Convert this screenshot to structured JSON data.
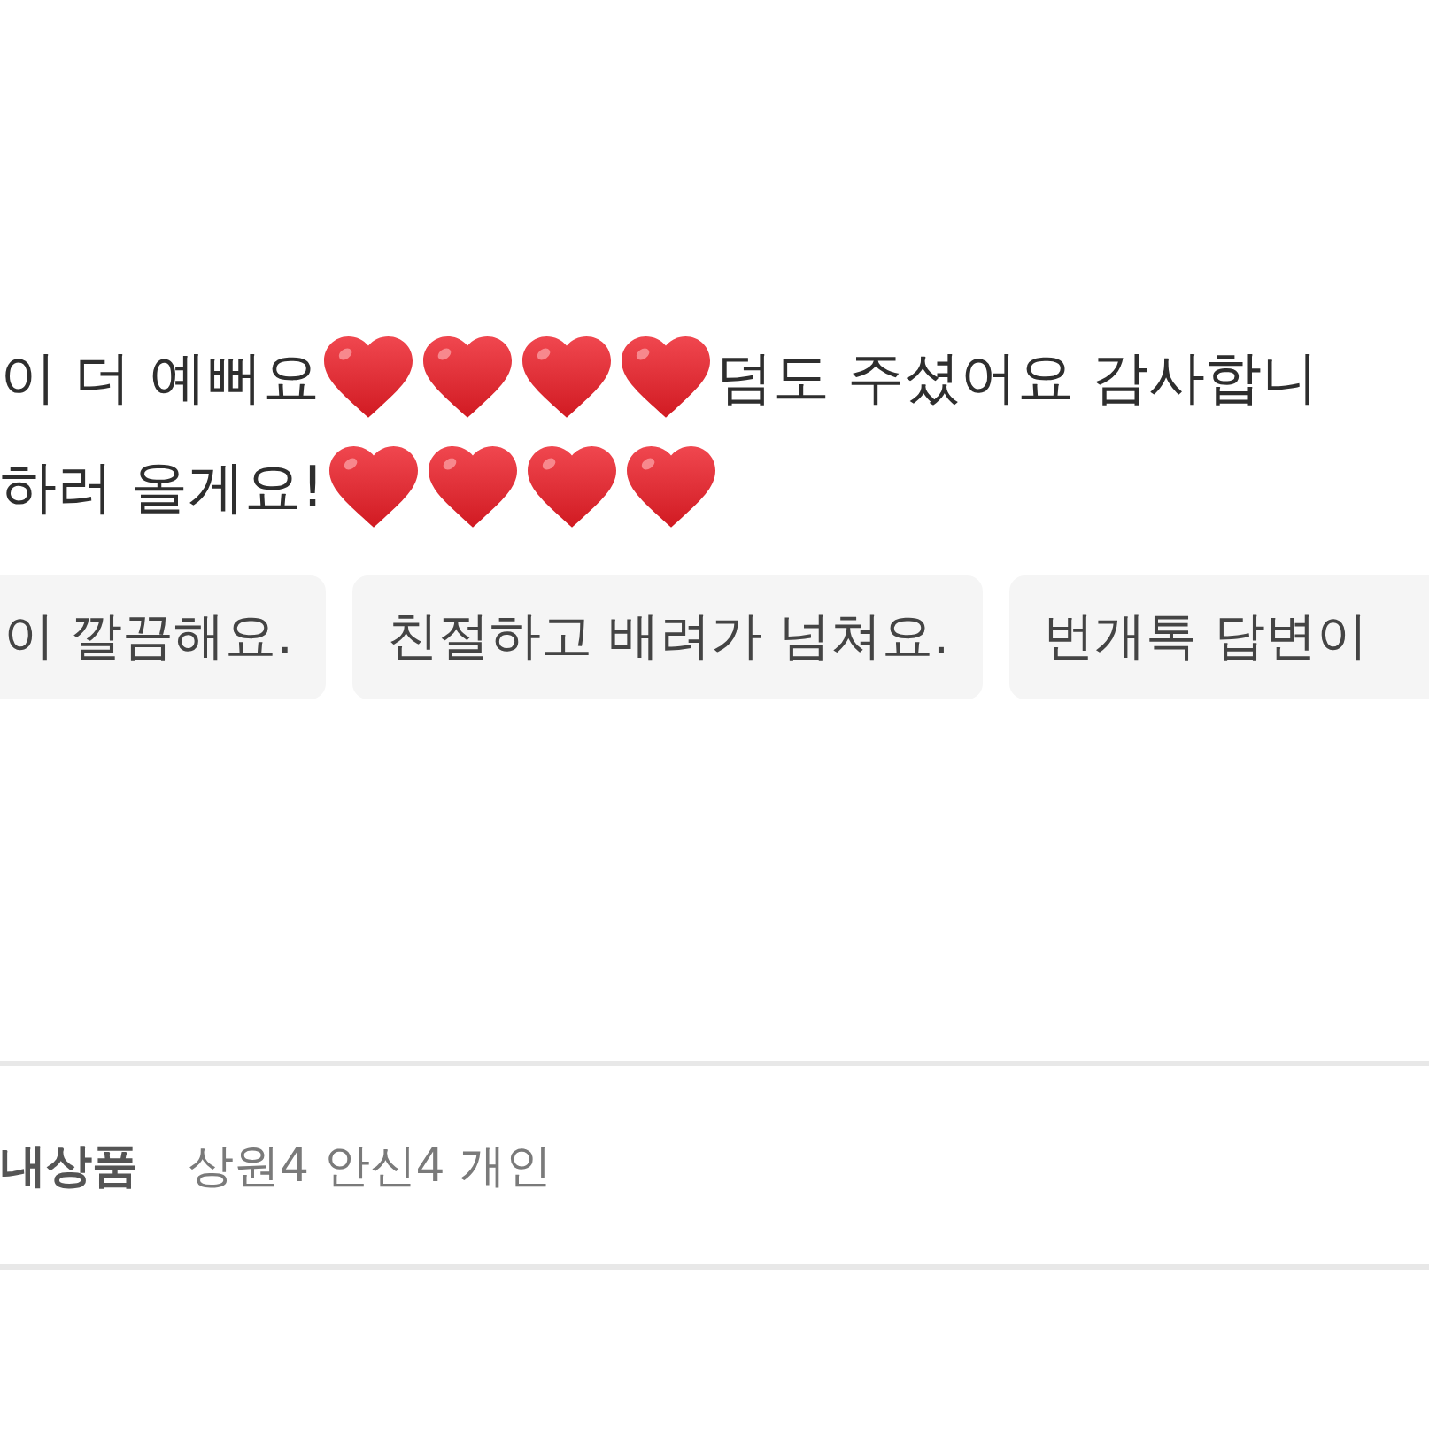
{
  "review": {
    "lines": [
      {
        "parts": [
          {
            "kind": "text",
            "text": "이 더 예뻐요"
          },
          {
            "kind": "emoji"
          },
          {
            "kind": "emoji"
          },
          {
            "kind": "emoji"
          },
          {
            "kind": "emoji"
          },
          {
            "kind": "text",
            "text": "덤도 주셨어요 감사합니"
          }
        ]
      },
      {
        "parts": [
          {
            "kind": "text",
            "text": "하러 올게요!"
          },
          {
            "kind": "emoji"
          },
          {
            "kind": "emoji"
          },
          {
            "kind": "emoji"
          },
          {
            "kind": "emoji"
          }
        ]
      }
    ]
  },
  "tags": [
    {
      "label": "이 깔끔해요."
    },
    {
      "label": "친절하고 배려가 넘쳐요."
    },
    {
      "label": "번개톡 답변이"
    }
  ],
  "product_row": {
    "label": "내상품",
    "value": "상원4 안신4 개인"
  }
}
